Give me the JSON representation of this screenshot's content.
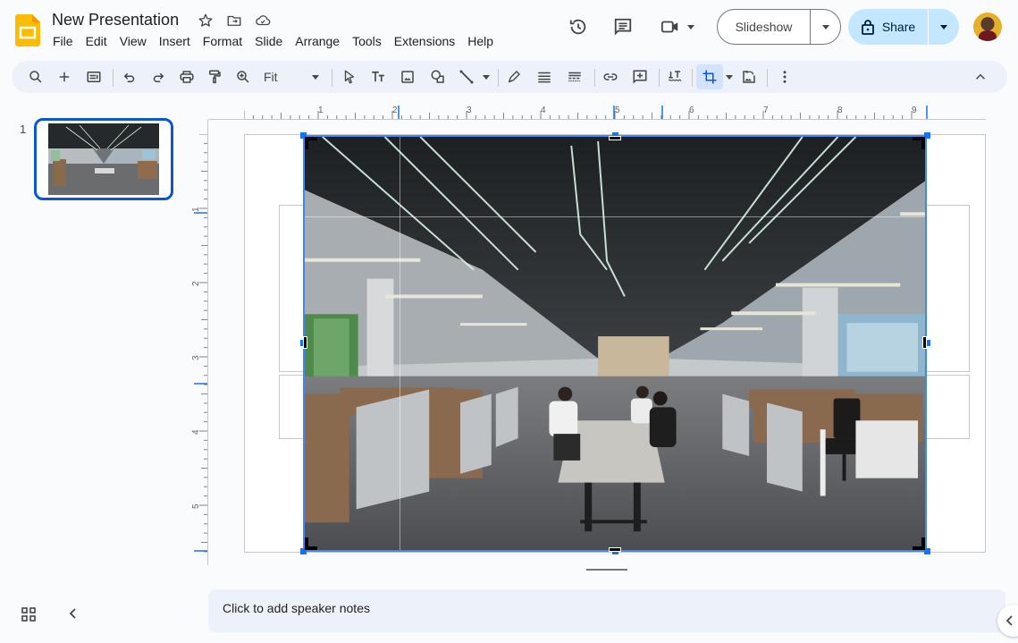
{
  "app": {
    "title": "New Presentation",
    "brand_color": "#fbbc04",
    "accent_color": "#0b57d0"
  },
  "title_icons": [
    {
      "name": "star-icon",
      "label": "Star"
    },
    {
      "name": "move-folder-icon",
      "label": "Move"
    },
    {
      "name": "cloud-saved-icon",
      "label": "Document status"
    }
  ],
  "menu": [
    "File",
    "Edit",
    "View",
    "Insert",
    "Format",
    "Slide",
    "Arrange",
    "Tools",
    "Extensions",
    "Help"
  ],
  "header": {
    "history_icon": "history-icon",
    "comments_icon": "comments-icon",
    "meet_icon": "video-camera-icon",
    "slideshow_label": "Slideshow",
    "share_label": "Share"
  },
  "toolbar": {
    "zoom_value": "Fit",
    "items": [
      "search-menus",
      "new-slide",
      "layout",
      "undo",
      "redo",
      "print",
      "paint-format",
      "zoom",
      "select",
      "text-box",
      "image",
      "shape",
      "line",
      "border-color",
      "border-weight",
      "border-dash",
      "insert-link",
      "add-comment",
      "alt-text",
      "crop-image",
      "reset-image",
      "more-options",
      "collapse-toolbar"
    ]
  },
  "filmstrip": {
    "slides": [
      {
        "number": "1",
        "selected": true
      }
    ]
  },
  "rulers": {
    "horizontal_labels": [
      "1",
      "2",
      "3",
      "4",
      "5",
      "6",
      "7",
      "8",
      "9"
    ],
    "vertical_labels": [
      "1",
      "2",
      "3",
      "4",
      "5"
    ]
  },
  "canvas": {
    "image_alt": "Open-plan office with people working at a long table",
    "mode": "crop"
  },
  "notes": {
    "placeholder": "Click to add speaker notes"
  },
  "bottom": {
    "grid_view_icon": "grid-view-icon",
    "collapse_icon": "chevron-left-icon",
    "side_panel_icon": "chevron-left-icon"
  }
}
